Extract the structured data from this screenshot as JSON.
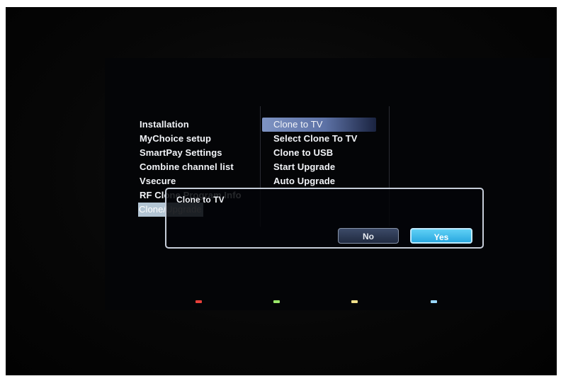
{
  "left_menu": {
    "items": [
      {
        "label": "Installation"
      },
      {
        "label": "MyChoice setup"
      },
      {
        "label": "SmartPay Settings"
      },
      {
        "label": "Combine channel list"
      },
      {
        "label": "Vsecure"
      },
      {
        "label": "RF Clone Program Info"
      },
      {
        "label": "Clone/Upgrade",
        "selected": true
      }
    ]
  },
  "right_menu": {
    "items": [
      {
        "label": "Clone to TV",
        "selected": true
      },
      {
        "label": "Select Clone To TV"
      },
      {
        "label": "Clone to USB"
      },
      {
        "label": "Start Upgrade"
      },
      {
        "label": "Auto Upgrade"
      }
    ]
  },
  "dialog": {
    "title": "Clone to TV",
    "no_label": "No",
    "yes_label": "Yes",
    "focused_button": "Yes"
  },
  "color_keys": {
    "red": "#e8403a",
    "green": "#9be86a",
    "yellow": "#f0e08a",
    "blue": "#9ad8ff"
  }
}
